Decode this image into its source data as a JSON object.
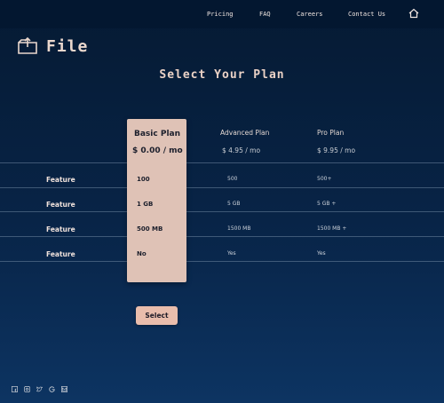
{
  "nav": {
    "items": [
      "Pricing",
      "FAQ",
      "Careers",
      "Contact Us"
    ],
    "home_icon": "home-icon"
  },
  "brand": {
    "logo_icon": "folder-upload-icon",
    "name": "File"
  },
  "page": {
    "title": "Select Your Plan"
  },
  "plans": [
    {
      "name": "Basic Plan",
      "price": "$ 0.00 / mo",
      "highlighted": true
    },
    {
      "name": "Advanced Plan",
      "price": "$ 4.95 / mo"
    },
    {
      "name": "Pro Plan",
      "price": "$ 9.95 / mo"
    }
  ],
  "features": [
    {
      "label": "Feature",
      "values": [
        "100",
        "500",
        "500+"
      ]
    },
    {
      "label": "Feature",
      "values": [
        "1 GB",
        "5 GB",
        "5 GB +"
      ]
    },
    {
      "label": "Feature",
      "values": [
        "500 MB",
        "1500 MB",
        "1500 MB +"
      ]
    },
    {
      "label": "Feature",
      "values": [
        "No",
        "Yes",
        "Yes"
      ]
    }
  ],
  "select_label": "Select",
  "social_icons": [
    "facebook-icon",
    "instagram-icon",
    "twitter-icon",
    "google-icon",
    "email-icon"
  ],
  "colors": {
    "accent": "#e9bdac",
    "highlight": "#dfc2b6",
    "background": "#082447"
  }
}
